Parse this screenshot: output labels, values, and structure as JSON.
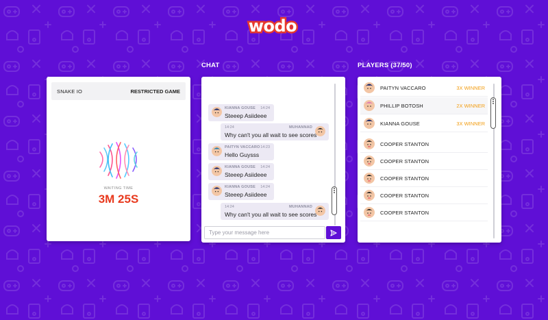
{
  "brand": {
    "logo_text": "wodo"
  },
  "game": {
    "name": "SNAKE IO",
    "mode": "RESTRICTED GAME",
    "waiting_label": "WAITING TIME",
    "waiting_time": "3M 25S"
  },
  "chat": {
    "title": "CHAT",
    "messages": [
      {
        "sender": "KIANNA GOUSE",
        "time": "14:24",
        "text": "Steeep Asiideee",
        "direction": "in"
      },
      {
        "sender": "MUHANNAD",
        "time": "14:24",
        "text": "Why can't you all wait to see scores",
        "direction": "out"
      },
      {
        "sender": "PAITYN VACCARO",
        "time": "14:23",
        "text": "Hello Guysss",
        "direction": "in"
      },
      {
        "sender": "KIANNA GOUSE",
        "time": "14:24",
        "text": "Steeep Asiideee",
        "direction": "in"
      },
      {
        "sender": "KIANNA GOUSE",
        "time": "14:24",
        "text": "Steeep Asiideee",
        "direction": "in"
      },
      {
        "sender": "MUHANNAD",
        "time": "14:24",
        "text": "Why can't you all wait to see scores",
        "direction": "out"
      }
    ],
    "input_placeholder": "Type your message here",
    "send_icon": "send-icon"
  },
  "players": {
    "title": "PLAYERS (37/50)",
    "list": [
      {
        "name": "PAITYN VACCARO",
        "badge": "3X WINNER"
      },
      {
        "name": "PHILLIP BOTOSH",
        "badge": "2X WINNER"
      },
      {
        "name": "KIANNA GOUSE",
        "badge": "3X WINNER"
      },
      {
        "name": "COOPER STANTON",
        "badge": ""
      },
      {
        "name": "COOPER STANTON",
        "badge": ""
      },
      {
        "name": "COOPER STANTON",
        "badge": ""
      },
      {
        "name": "COOPER STANTON",
        "badge": ""
      },
      {
        "name": "COOPER STANTON",
        "badge": ""
      }
    ]
  },
  "colors": {
    "background": "#5f0fd6",
    "accent_red": "#e8391d",
    "winner_orange": "#f29d12"
  }
}
